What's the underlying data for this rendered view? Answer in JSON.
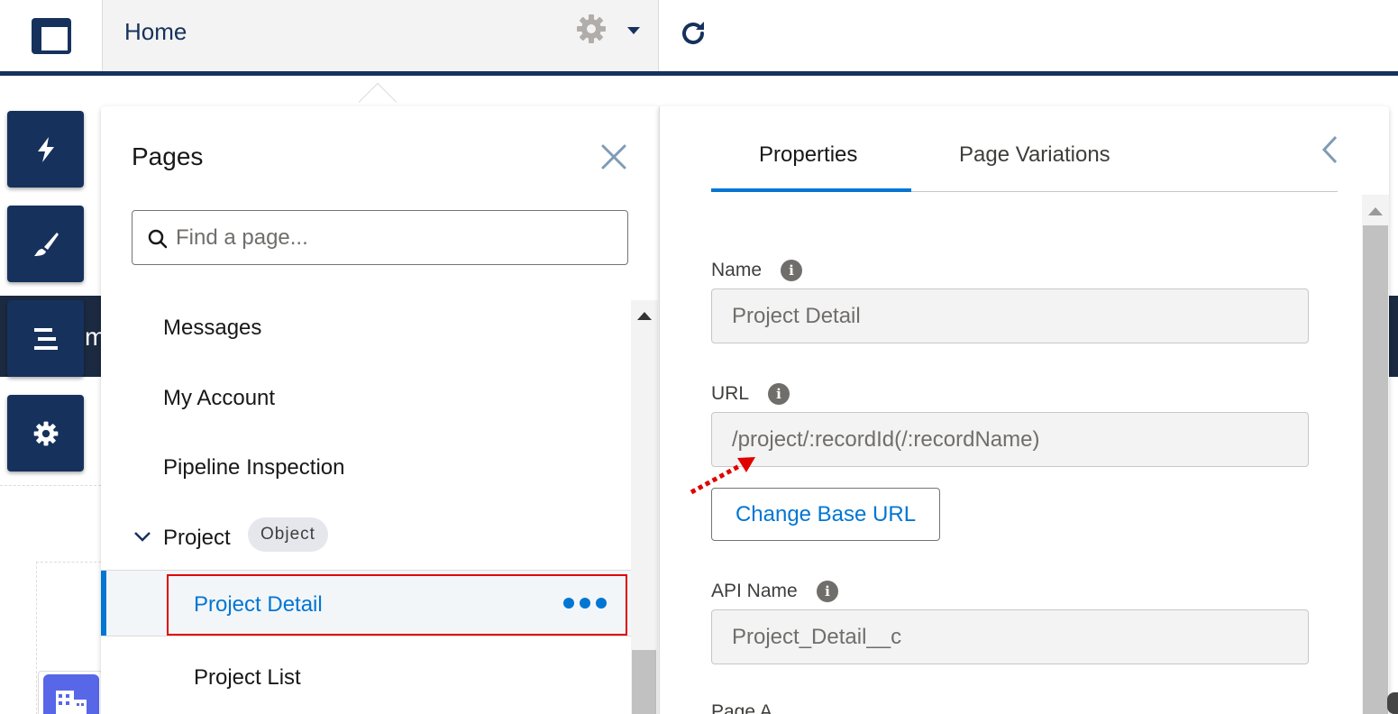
{
  "topbar": {
    "page_title": "Home",
    "logo_icon": "builder-layout-icon",
    "settings_icon": "gear-icon",
    "dropdown_icon": "caret-down-icon",
    "refresh_icon": "refresh-icon"
  },
  "background": {
    "band_text": "m"
  },
  "rail": {
    "items": [
      {
        "icon": "lightning-icon"
      },
      {
        "icon": "brush-icon"
      },
      {
        "icon": "list-icon"
      },
      {
        "icon": "gear-icon"
      }
    ]
  },
  "pages_panel": {
    "title": "Pages",
    "search_placeholder": "Find a page...",
    "items": [
      {
        "label": "Messages"
      },
      {
        "label": "My Account"
      },
      {
        "label": "Pipeline Inspection"
      }
    ],
    "group": {
      "label": "Project",
      "badge": "Object"
    },
    "selected": {
      "label": "Project Detail"
    },
    "after": [
      {
        "label": "Project List"
      }
    ]
  },
  "props_panel": {
    "tabs": [
      {
        "label": "Properties",
        "active": true
      },
      {
        "label": "Page Variations",
        "active": false
      }
    ],
    "name_label": "Name",
    "name_value": "Project Detail",
    "url_label": "URL",
    "url_value": "/project/:recordId(/:recordName)",
    "change_base_url": "Change Base URL",
    "api_label": "API Name",
    "api_value": "Project_Detail__c",
    "cut_label": "Page A..."
  },
  "colors": {
    "navy": "#16325c",
    "accent": "#0176d3",
    "highlight": "#e00000"
  }
}
